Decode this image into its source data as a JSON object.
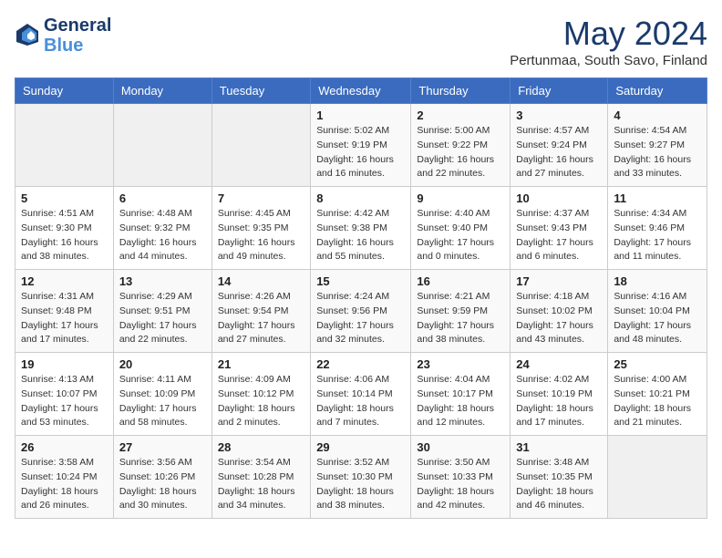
{
  "header": {
    "logo_line1": "General",
    "logo_line2": "Blue",
    "month_title": "May 2024",
    "location": "Pertunmaa, South Savo, Finland"
  },
  "weekdays": [
    "Sunday",
    "Monday",
    "Tuesday",
    "Wednesday",
    "Thursday",
    "Friday",
    "Saturday"
  ],
  "weeks": [
    [
      {
        "day": "",
        "info": ""
      },
      {
        "day": "",
        "info": ""
      },
      {
        "day": "",
        "info": ""
      },
      {
        "day": "1",
        "info": "Sunrise: 5:02 AM\nSunset: 9:19 PM\nDaylight: 16 hours\nand 16 minutes."
      },
      {
        "day": "2",
        "info": "Sunrise: 5:00 AM\nSunset: 9:22 PM\nDaylight: 16 hours\nand 22 minutes."
      },
      {
        "day": "3",
        "info": "Sunrise: 4:57 AM\nSunset: 9:24 PM\nDaylight: 16 hours\nand 27 minutes."
      },
      {
        "day": "4",
        "info": "Sunrise: 4:54 AM\nSunset: 9:27 PM\nDaylight: 16 hours\nand 33 minutes."
      }
    ],
    [
      {
        "day": "5",
        "info": "Sunrise: 4:51 AM\nSunset: 9:30 PM\nDaylight: 16 hours\nand 38 minutes."
      },
      {
        "day": "6",
        "info": "Sunrise: 4:48 AM\nSunset: 9:32 PM\nDaylight: 16 hours\nand 44 minutes."
      },
      {
        "day": "7",
        "info": "Sunrise: 4:45 AM\nSunset: 9:35 PM\nDaylight: 16 hours\nand 49 minutes."
      },
      {
        "day": "8",
        "info": "Sunrise: 4:42 AM\nSunset: 9:38 PM\nDaylight: 16 hours\nand 55 minutes."
      },
      {
        "day": "9",
        "info": "Sunrise: 4:40 AM\nSunset: 9:40 PM\nDaylight: 17 hours\nand 0 minutes."
      },
      {
        "day": "10",
        "info": "Sunrise: 4:37 AM\nSunset: 9:43 PM\nDaylight: 17 hours\nand 6 minutes."
      },
      {
        "day": "11",
        "info": "Sunrise: 4:34 AM\nSunset: 9:46 PM\nDaylight: 17 hours\nand 11 minutes."
      }
    ],
    [
      {
        "day": "12",
        "info": "Sunrise: 4:31 AM\nSunset: 9:48 PM\nDaylight: 17 hours\nand 17 minutes."
      },
      {
        "day": "13",
        "info": "Sunrise: 4:29 AM\nSunset: 9:51 PM\nDaylight: 17 hours\nand 22 minutes."
      },
      {
        "day": "14",
        "info": "Sunrise: 4:26 AM\nSunset: 9:54 PM\nDaylight: 17 hours\nand 27 minutes."
      },
      {
        "day": "15",
        "info": "Sunrise: 4:24 AM\nSunset: 9:56 PM\nDaylight: 17 hours\nand 32 minutes."
      },
      {
        "day": "16",
        "info": "Sunrise: 4:21 AM\nSunset: 9:59 PM\nDaylight: 17 hours\nand 38 minutes."
      },
      {
        "day": "17",
        "info": "Sunrise: 4:18 AM\nSunset: 10:02 PM\nDaylight: 17 hours\nand 43 minutes."
      },
      {
        "day": "18",
        "info": "Sunrise: 4:16 AM\nSunset: 10:04 PM\nDaylight: 17 hours\nand 48 minutes."
      }
    ],
    [
      {
        "day": "19",
        "info": "Sunrise: 4:13 AM\nSunset: 10:07 PM\nDaylight: 17 hours\nand 53 minutes."
      },
      {
        "day": "20",
        "info": "Sunrise: 4:11 AM\nSunset: 10:09 PM\nDaylight: 17 hours\nand 58 minutes."
      },
      {
        "day": "21",
        "info": "Sunrise: 4:09 AM\nSunset: 10:12 PM\nDaylight: 18 hours\nand 2 minutes."
      },
      {
        "day": "22",
        "info": "Sunrise: 4:06 AM\nSunset: 10:14 PM\nDaylight: 18 hours\nand 7 minutes."
      },
      {
        "day": "23",
        "info": "Sunrise: 4:04 AM\nSunset: 10:17 PM\nDaylight: 18 hours\nand 12 minutes."
      },
      {
        "day": "24",
        "info": "Sunrise: 4:02 AM\nSunset: 10:19 PM\nDaylight: 18 hours\nand 17 minutes."
      },
      {
        "day": "25",
        "info": "Sunrise: 4:00 AM\nSunset: 10:21 PM\nDaylight: 18 hours\nand 21 minutes."
      }
    ],
    [
      {
        "day": "26",
        "info": "Sunrise: 3:58 AM\nSunset: 10:24 PM\nDaylight: 18 hours\nand 26 minutes."
      },
      {
        "day": "27",
        "info": "Sunrise: 3:56 AM\nSunset: 10:26 PM\nDaylight: 18 hours\nand 30 minutes."
      },
      {
        "day": "28",
        "info": "Sunrise: 3:54 AM\nSunset: 10:28 PM\nDaylight: 18 hours\nand 34 minutes."
      },
      {
        "day": "29",
        "info": "Sunrise: 3:52 AM\nSunset: 10:30 PM\nDaylight: 18 hours\nand 38 minutes."
      },
      {
        "day": "30",
        "info": "Sunrise: 3:50 AM\nSunset: 10:33 PM\nDaylight: 18 hours\nand 42 minutes."
      },
      {
        "day": "31",
        "info": "Sunrise: 3:48 AM\nSunset: 10:35 PM\nDaylight: 18 hours\nand 46 minutes."
      },
      {
        "day": "",
        "info": ""
      }
    ]
  ]
}
